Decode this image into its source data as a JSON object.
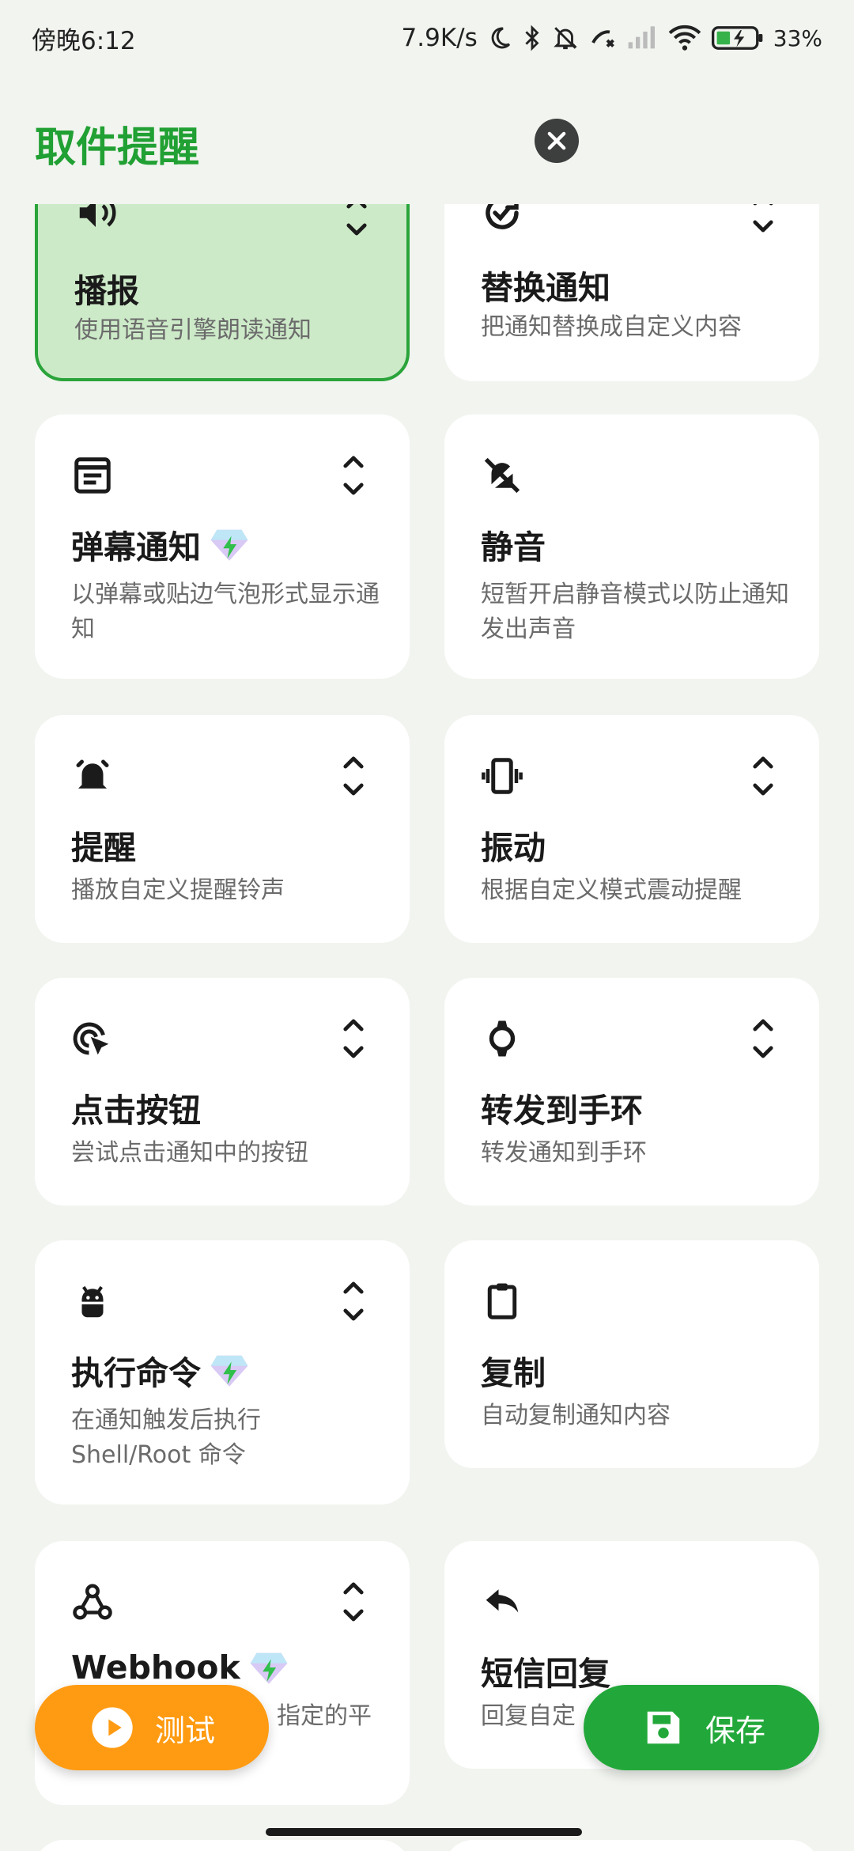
{
  "status_bar": {
    "time": "傍晚6:12",
    "net_speed": "7.9K/s",
    "battery": "33%"
  },
  "header": {
    "title": "取件提醒"
  },
  "cards": [
    {
      "title": "播报",
      "desc": "使用语音引擎朗读通知",
      "icon": "speaker-icon",
      "expandable": true,
      "active": true
    },
    {
      "title": "替换通知",
      "desc": "把通知替换成自定义内容",
      "icon": "replace-icon",
      "expandable": true
    },
    {
      "title": "弹幕通知",
      "desc": "以弹幕或贴边气泡形式显示通知",
      "icon": "danmaku-icon",
      "expandable": true,
      "premium": true
    },
    {
      "title": "静音",
      "desc": "短暂开启静音模式以防止通知发出声音",
      "icon": "bell-off-icon",
      "expandable": false
    },
    {
      "title": "提醒",
      "desc": "播放自定义提醒铃声",
      "icon": "bell-ring-icon",
      "expandable": true
    },
    {
      "title": "振动",
      "desc": "根据自定义模式震动提醒",
      "icon": "vibrate-icon",
      "expandable": true
    },
    {
      "title": "点击按钮",
      "desc": "尝试点击通知中的按钮",
      "icon": "click-icon",
      "expandable": true
    },
    {
      "title": "转发到手环",
      "desc": "转发通知到手环",
      "icon": "watch-icon",
      "expandable": true
    },
    {
      "title": "执行命令",
      "desc": "在通知触发后执行 Shell/Root 命令",
      "icon": "android-icon",
      "expandable": true,
      "premium": true
    },
    {
      "title": "复制",
      "desc": "自动复制通知内容",
      "icon": "clipboard-icon",
      "expandable": false
    },
    {
      "title": "Webhook",
      "desc": "指定的平",
      "icon": "webhook-icon",
      "expandable": true,
      "premium": true
    },
    {
      "title": "短信回复",
      "desc": "回复自定",
      "icon": "reply-icon",
      "expandable": false
    }
  ],
  "buttons": {
    "test": "测试",
    "save": "保存"
  },
  "colors": {
    "accent": "#21a033",
    "active_card": "#cdeac8",
    "test_button": "#ff9b12",
    "save_button": "#22a83a"
  }
}
